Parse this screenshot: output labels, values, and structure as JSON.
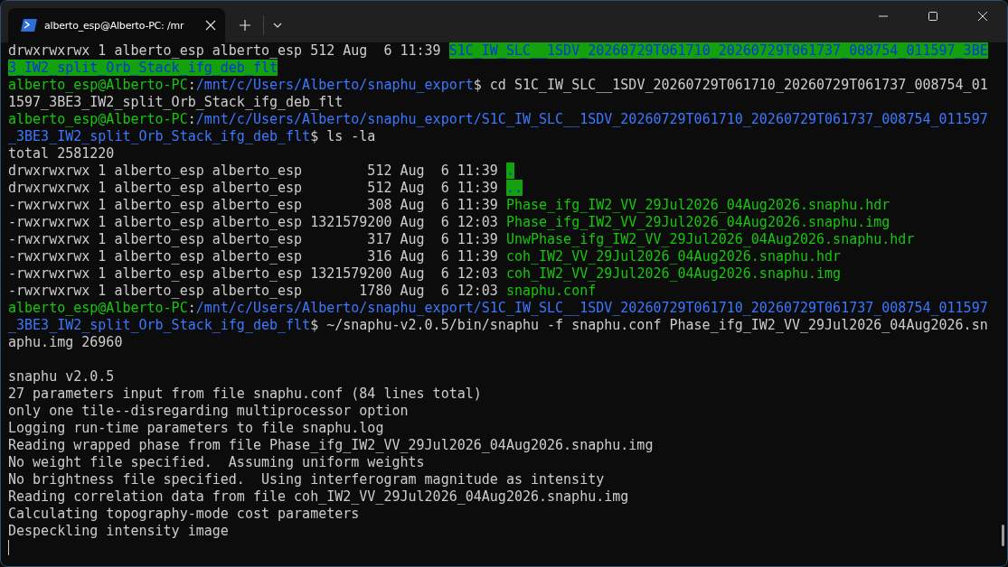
{
  "window": {
    "tab": {
      "title": "alberto_esp@Alberto-PC: /mr",
      "selected": true
    }
  },
  "terminal": {
    "lines": [
      {
        "kind": "text",
        "segments": [
          {
            "kind": "plain",
            "text": "drwxrwxrwx 1 alberto_esp alberto_esp 512 Aug  6 11:39 "
          },
          {
            "kind": "dir",
            "text": "S1C_IW_SLC__1SDV_20260729T061710_20260729T061737_008754_011597_3BE"
          }
        ]
      },
      {
        "kind": "text",
        "segments": [
          {
            "kind": "dir",
            "text": "3_IW2_split_Orb_Stack_ifg_deb_flt"
          }
        ]
      },
      {
        "kind": "text",
        "segments": [
          {
            "kind": "user",
            "text": "alberto_esp@Alberto-PC"
          },
          {
            "kind": "plain",
            "text": ":"
          },
          {
            "kind": "path",
            "text": "/mnt/c/Users/Alberto/snaphu_export"
          },
          {
            "kind": "plain",
            "text": "$ cd S1C_IW_SLC__1SDV_20260729T061710_20260729T061737_008754_01"
          }
        ]
      },
      {
        "kind": "text",
        "segments": [
          {
            "kind": "plain",
            "text": "1597_3BE3_IW2_split_Orb_Stack_ifg_deb_flt"
          }
        ]
      },
      {
        "kind": "text",
        "segments": [
          {
            "kind": "user",
            "text": "alberto_esp@Alberto-PC"
          },
          {
            "kind": "plain",
            "text": ":"
          },
          {
            "kind": "path",
            "text": "/mnt/c/Users/Alberto/snaphu_export/S1C_IW_SLC__1SDV_20260729T061710_20260729T061737_008754_011597"
          }
        ]
      },
      {
        "kind": "text",
        "segments": [
          {
            "kind": "path",
            "text": "_3BE3_IW2_split_Orb_Stack_ifg_deb_flt"
          },
          {
            "kind": "plain",
            "text": "$ ls -la"
          }
        ]
      },
      {
        "kind": "text",
        "segments": [
          {
            "kind": "plain",
            "text": "total 2581220"
          }
        ]
      },
      {
        "kind": "text",
        "segments": [
          {
            "kind": "plain",
            "text": "drwxrwxrwx 1 alberto_esp alberto_esp        512 Aug  6 11:39 "
          },
          {
            "kind": "dir",
            "text": "."
          }
        ]
      },
      {
        "kind": "text",
        "segments": [
          {
            "kind": "plain",
            "text": "drwxrwxrwx 1 alberto_esp alberto_esp        512 Aug  6 11:39 "
          },
          {
            "kind": "dir",
            "text": ".."
          }
        ]
      },
      {
        "kind": "text",
        "segments": [
          {
            "kind": "plain",
            "text": "-rwxrwxrwx 1 alberto_esp alberto_esp        308 Aug  6 11:39 "
          },
          {
            "kind": "exec",
            "text": "Phase_ifg_IW2_VV_29Jul2026_04Aug2026.snaphu.hdr"
          }
        ]
      },
      {
        "kind": "text",
        "segments": [
          {
            "kind": "plain",
            "text": "-rwxrwxrwx 1 alberto_esp alberto_esp 1321579200 Aug  6 12:03 "
          },
          {
            "kind": "exec",
            "text": "Phase_ifg_IW2_VV_29Jul2026_04Aug2026.snaphu.img"
          }
        ]
      },
      {
        "kind": "text",
        "segments": [
          {
            "kind": "plain",
            "text": "-rwxrwxrwx 1 alberto_esp alberto_esp        317 Aug  6 11:39 "
          },
          {
            "kind": "exec",
            "text": "UnwPhase_ifg_IW2_VV_29Jul2026_04Aug2026.snaphu.hdr"
          }
        ]
      },
      {
        "kind": "text",
        "segments": [
          {
            "kind": "plain",
            "text": "-rwxrwxrwx 1 alberto_esp alberto_esp        316 Aug  6 11:39 "
          },
          {
            "kind": "exec",
            "text": "coh_IW2_VV_29Jul2026_04Aug2026.snaphu.hdr"
          }
        ]
      },
      {
        "kind": "text",
        "segments": [
          {
            "kind": "plain",
            "text": "-rwxrwxrwx 1 alberto_esp alberto_esp 1321579200 Aug  6 12:03 "
          },
          {
            "kind": "exec",
            "text": "coh_IW2_VV_29Jul2026_04Aug2026.snaphu.img"
          }
        ]
      },
      {
        "kind": "text",
        "segments": [
          {
            "kind": "plain",
            "text": "-rwxrwxrwx 1 alberto_esp alberto_esp       1780 Aug  6 12:03 "
          },
          {
            "kind": "exec",
            "text": "snaphu.conf"
          }
        ]
      },
      {
        "kind": "text",
        "segments": [
          {
            "kind": "user",
            "text": "alberto_esp@Alberto-PC"
          },
          {
            "kind": "plain",
            "text": ":"
          },
          {
            "kind": "path",
            "text": "/mnt/c/Users/Alberto/snaphu_export/S1C_IW_SLC__1SDV_20260729T061710_20260729T061737_008754_011597"
          }
        ]
      },
      {
        "kind": "text",
        "segments": [
          {
            "kind": "path",
            "text": "_3BE3_IW2_split_Orb_Stack_ifg_deb_flt"
          },
          {
            "kind": "plain",
            "text": "$ ~/snaphu-v2.0.5/bin/snaphu -f snaphu.conf Phase_ifg_IW2_VV_29Jul2026_04Aug2026.sn"
          }
        ]
      },
      {
        "kind": "text",
        "segments": [
          {
            "kind": "plain",
            "text": "aphu.img 26960"
          }
        ]
      },
      {
        "kind": "blank"
      },
      {
        "kind": "text",
        "segments": [
          {
            "kind": "plain",
            "text": "snaphu v2.0.5"
          }
        ]
      },
      {
        "kind": "text",
        "segments": [
          {
            "kind": "plain",
            "text": "27 parameters input from file snaphu.conf (84 lines total)"
          }
        ]
      },
      {
        "kind": "text",
        "segments": [
          {
            "kind": "plain",
            "text": "only one tile--disregarding multiprocessor option"
          }
        ]
      },
      {
        "kind": "text",
        "segments": [
          {
            "kind": "plain",
            "text": "Logging run-time parameters to file snaphu.log"
          }
        ]
      },
      {
        "kind": "text",
        "segments": [
          {
            "kind": "plain",
            "text": "Reading wrapped phase from file Phase_ifg_IW2_VV_29Jul2026_04Aug2026.snaphu.img"
          }
        ]
      },
      {
        "kind": "text",
        "segments": [
          {
            "kind": "plain",
            "text": "No weight file specified.  Assuming uniform weights"
          }
        ]
      },
      {
        "kind": "text",
        "segments": [
          {
            "kind": "plain",
            "text": "No brightness file specified.  Using interferogram magnitude as intensity"
          }
        ]
      },
      {
        "kind": "text",
        "segments": [
          {
            "kind": "plain",
            "text": "Reading correlation data from file coh_IW2_VV_29Jul2026_04Aug2026.snaphu.img"
          }
        ]
      },
      {
        "kind": "text",
        "segments": [
          {
            "kind": "plain",
            "text": "Calculating topography-mode cost parameters"
          }
        ]
      },
      {
        "kind": "text",
        "segments": [
          {
            "kind": "plain",
            "text": "Despeckling intensity image"
          }
        ]
      },
      {
        "kind": "cursor"
      }
    ]
  }
}
